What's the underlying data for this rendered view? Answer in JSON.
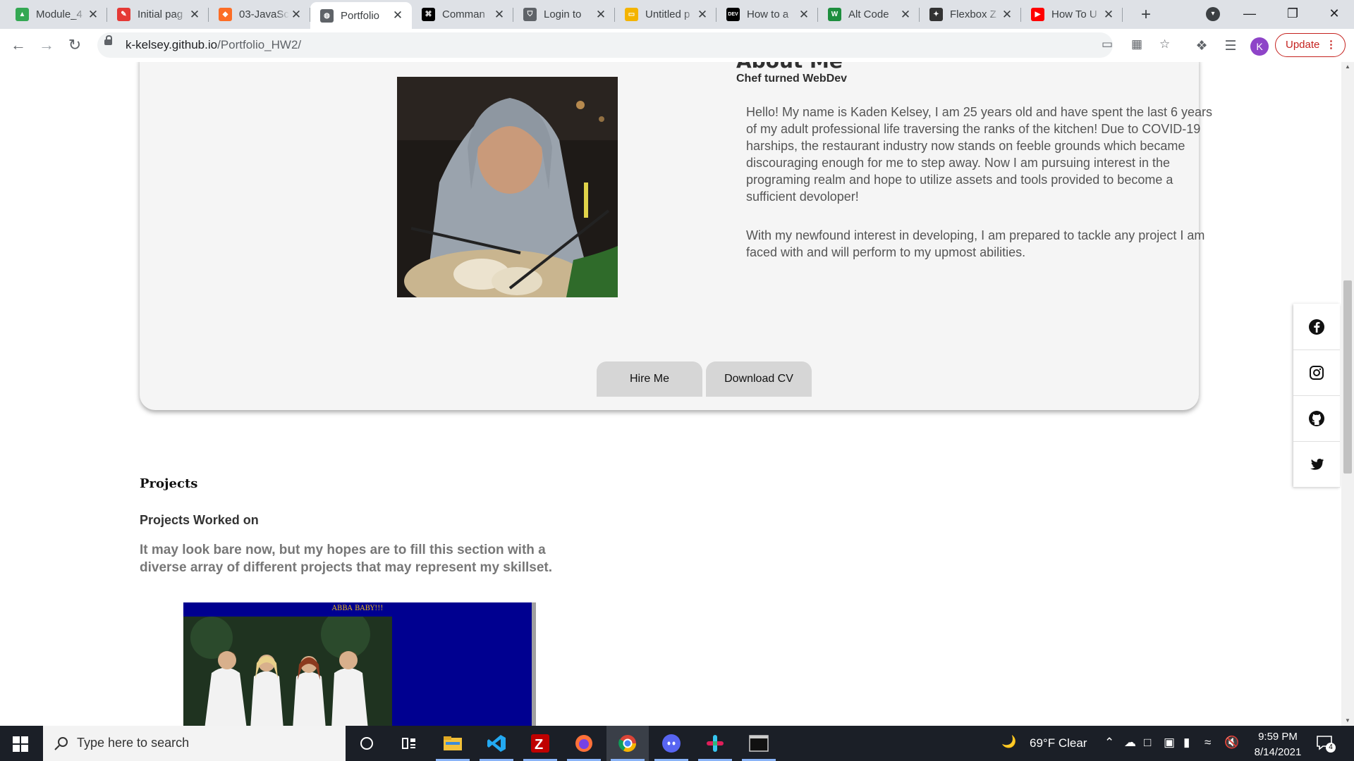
{
  "browser": {
    "tabs": [
      {
        "title": "Module_4",
        "favicon": "google-drive-icon",
        "color": "#34a853"
      },
      {
        "title": "Initial pag",
        "favicon": "pencil-icon",
        "color": "#e53935"
      },
      {
        "title": "03-JavaSc",
        "favicon": "gitlab-icon",
        "color": "#fc6d26"
      },
      {
        "title": "Portfolio",
        "favicon": "globe-icon",
        "color": "#5f6368"
      },
      {
        "title": "Comman",
        "favicon": "command-icon",
        "color": "#000000"
      },
      {
        "title": "Login to",
        "favicon": "shield-icon",
        "color": "#5f6368"
      },
      {
        "title": "Untitled p",
        "favicon": "slides-icon",
        "color": "#f4b400"
      },
      {
        "title": "How to a",
        "favicon": "dev-icon",
        "color": "#000000"
      },
      {
        "title": "Alt Code",
        "favicon": "wn-icon",
        "color": "#1e8e3e"
      },
      {
        "title": "Flexbox Z",
        "favicon": "flexbox-icon",
        "color": "#333333"
      },
      {
        "title": "How To U",
        "favicon": "youtube-icon",
        "color": "#ff0000"
      }
    ],
    "active_tab_index": 3,
    "url_host": "k-kelsey.github.io",
    "url_path": "/Portfolio_HW2/",
    "avatar_letter": "K",
    "update_label": "Update"
  },
  "about": {
    "title": "About Me",
    "subtitle": "Chef turned WebDev",
    "paragraph1": "Hello! My name is Kaden Kelsey, I am 25 years old and have spent the last 6 years of my adult professional life traversing the ranks of the kitchen! Due to COVID-19 harships, the restaurant industry now stands on feeble grounds which became discouraging enough for me to step away. Now I am pursuing interest in the programing realm and hope to utilize assets and tools provided to become a sufficient devoloper!",
    "paragraph2": "With my newfound interest in developing, I am prepared to tackle any project I am faced with and will perform to my upmost abilities.",
    "hire_label": "Hire Me",
    "cv_label": "Download CV"
  },
  "projects": {
    "heading": "Projects",
    "subheading": "Projects Worked on",
    "text": "It may look bare now, but my hopes are to fill this section with a diverse array of different projects that may represent my skillset.",
    "sample_caption": "ABBA BABY!!!"
  },
  "social": [
    "facebook-icon",
    "instagram-icon",
    "github-icon",
    "twitter-icon"
  ],
  "taskbar": {
    "search_placeholder": "Type here to search",
    "weather": "69°F  Clear",
    "time": "9:59 PM",
    "date": "8/14/2021",
    "notifications": "4"
  }
}
